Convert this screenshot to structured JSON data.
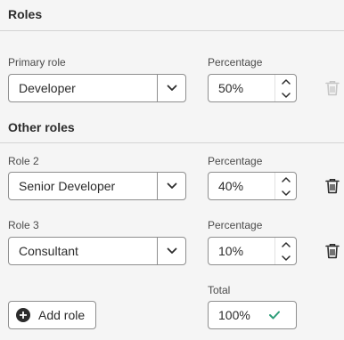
{
  "roles_section": {
    "title": "Roles"
  },
  "primary": {
    "role_label": "Primary role",
    "role_value": "Developer",
    "percentage_label": "Percentage",
    "percentage_value": "50%"
  },
  "other_section": {
    "title": "Other roles"
  },
  "role2": {
    "role_label": "Role 2",
    "role_value": "Senior Developer",
    "percentage_label": "Percentage",
    "percentage_value": "40%"
  },
  "role3": {
    "role_label": "Role 3",
    "role_value": "Consultant",
    "percentage_label": "Percentage",
    "percentage_value": "10%"
  },
  "total": {
    "label": "Total",
    "value": "100%",
    "status_icon": "checkmark-icon",
    "status_color": "#2d9d78"
  },
  "add_role": {
    "label": "Add role",
    "icon": "add-circle-icon"
  },
  "icons": {
    "dropdown": "chevron-down-icon",
    "increment": "chevron-up-icon",
    "decrement": "chevron-down-icon",
    "delete": "trash-icon"
  },
  "colors": {
    "background": "#f5f5f5",
    "border": "#8e8e8e",
    "disabled_icon": "#c6c6c6",
    "text": "#2c2c2c"
  }
}
